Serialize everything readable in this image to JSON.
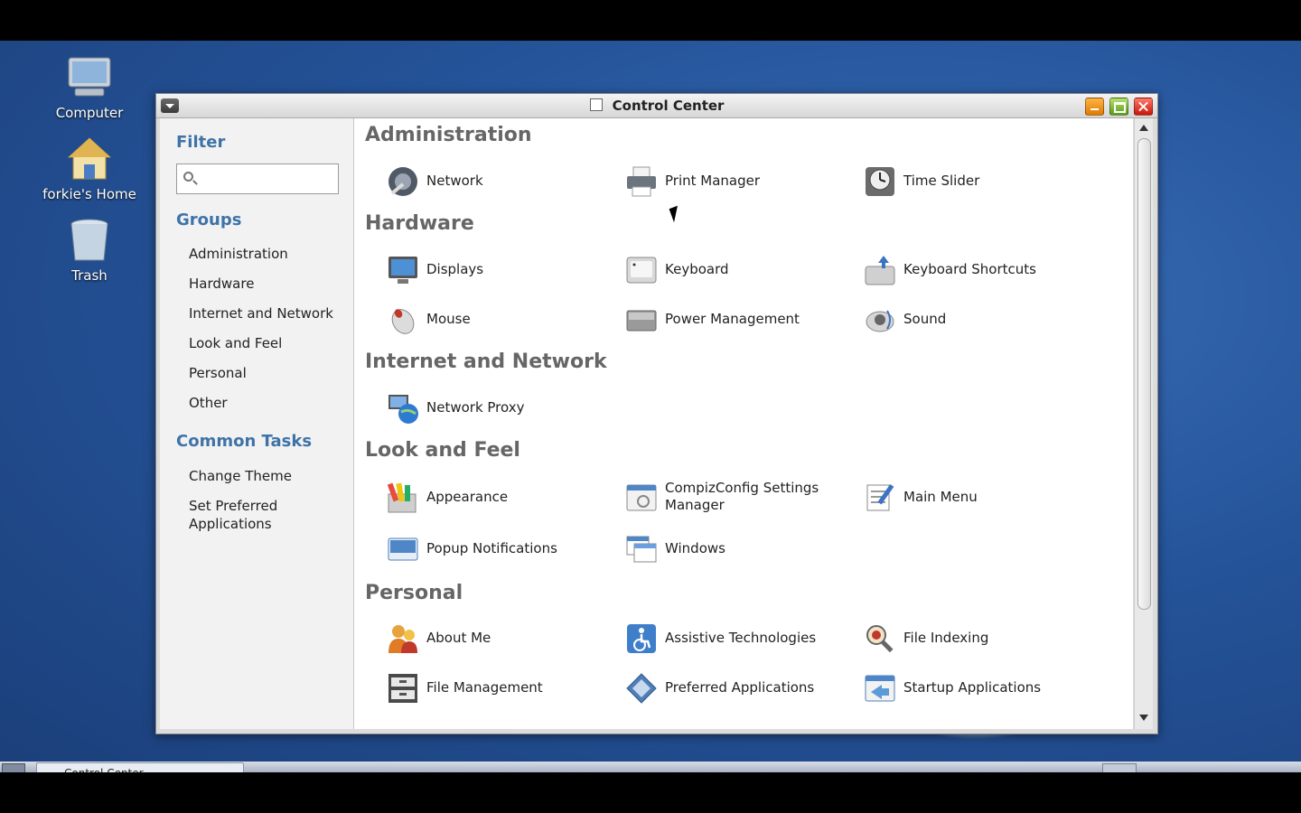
{
  "desktop": {
    "icons": [
      {
        "label": "Computer",
        "icon": "computer-icon"
      },
      {
        "label": "forkie's Home",
        "icon": "home-folder-icon"
      },
      {
        "label": "Trash",
        "icon": "trash-icon"
      }
    ]
  },
  "window": {
    "title": "Control Center"
  },
  "sidebar": {
    "filter_heading": "Filter",
    "filter_value": "",
    "groups_heading": "Groups",
    "groups": [
      "Administration",
      "Hardware",
      "Internet and Network",
      "Look and Feel",
      "Personal",
      "Other"
    ],
    "tasks_heading": "Common Tasks",
    "tasks": [
      "Change Theme",
      "Set Preferred Applications"
    ]
  },
  "sections": [
    {
      "title": "Administration",
      "items": [
        {
          "label": "Network",
          "icon": "network-tools-icon"
        },
        {
          "label": "Print Manager",
          "icon": "printer-icon"
        },
        {
          "label": "Time Slider",
          "icon": "clock-icon"
        }
      ]
    },
    {
      "title": "Hardware",
      "items": [
        {
          "label": "Displays",
          "icon": "monitor-icon"
        },
        {
          "label": "Keyboard",
          "icon": "keyboard-icon"
        },
        {
          "label": "Keyboard Shortcuts",
          "icon": "keyboard-shortcuts-icon"
        },
        {
          "label": "Mouse",
          "icon": "mouse-icon"
        },
        {
          "label": "Power Management",
          "icon": "battery-icon"
        },
        {
          "label": "Sound",
          "icon": "speaker-icon"
        }
      ]
    },
    {
      "title": "Internet and Network",
      "items": [
        {
          "label": "Network Proxy",
          "icon": "globe-icon"
        }
      ]
    },
    {
      "title": "Look and Feel",
      "items": [
        {
          "label": "Appearance",
          "icon": "paint-icon"
        },
        {
          "label": "CompizConfig Settings Manager",
          "icon": "compiz-icon"
        },
        {
          "label": "Main Menu",
          "icon": "menu-edit-icon"
        },
        {
          "label": "Popup Notifications",
          "icon": "notification-icon"
        },
        {
          "label": "Windows",
          "icon": "windows-icon"
        }
      ]
    },
    {
      "title": "Personal",
      "items": [
        {
          "label": "About Me",
          "icon": "people-icon"
        },
        {
          "label": "Assistive Technologies",
          "icon": "accessibility-icon"
        },
        {
          "label": "File Indexing",
          "icon": "file-search-icon"
        },
        {
          "label": "File Management",
          "icon": "file-cabinet-icon"
        },
        {
          "label": "Preferred Applications",
          "icon": "preferred-apps-icon"
        },
        {
          "label": "Startup Applications",
          "icon": "startup-icon"
        }
      ]
    }
  ],
  "taskbar": {
    "task_label": "Control Center"
  },
  "colors": {
    "desktop_blue": "#25549a",
    "heading_blue": "#3f73a8",
    "section_gray": "#666666"
  }
}
